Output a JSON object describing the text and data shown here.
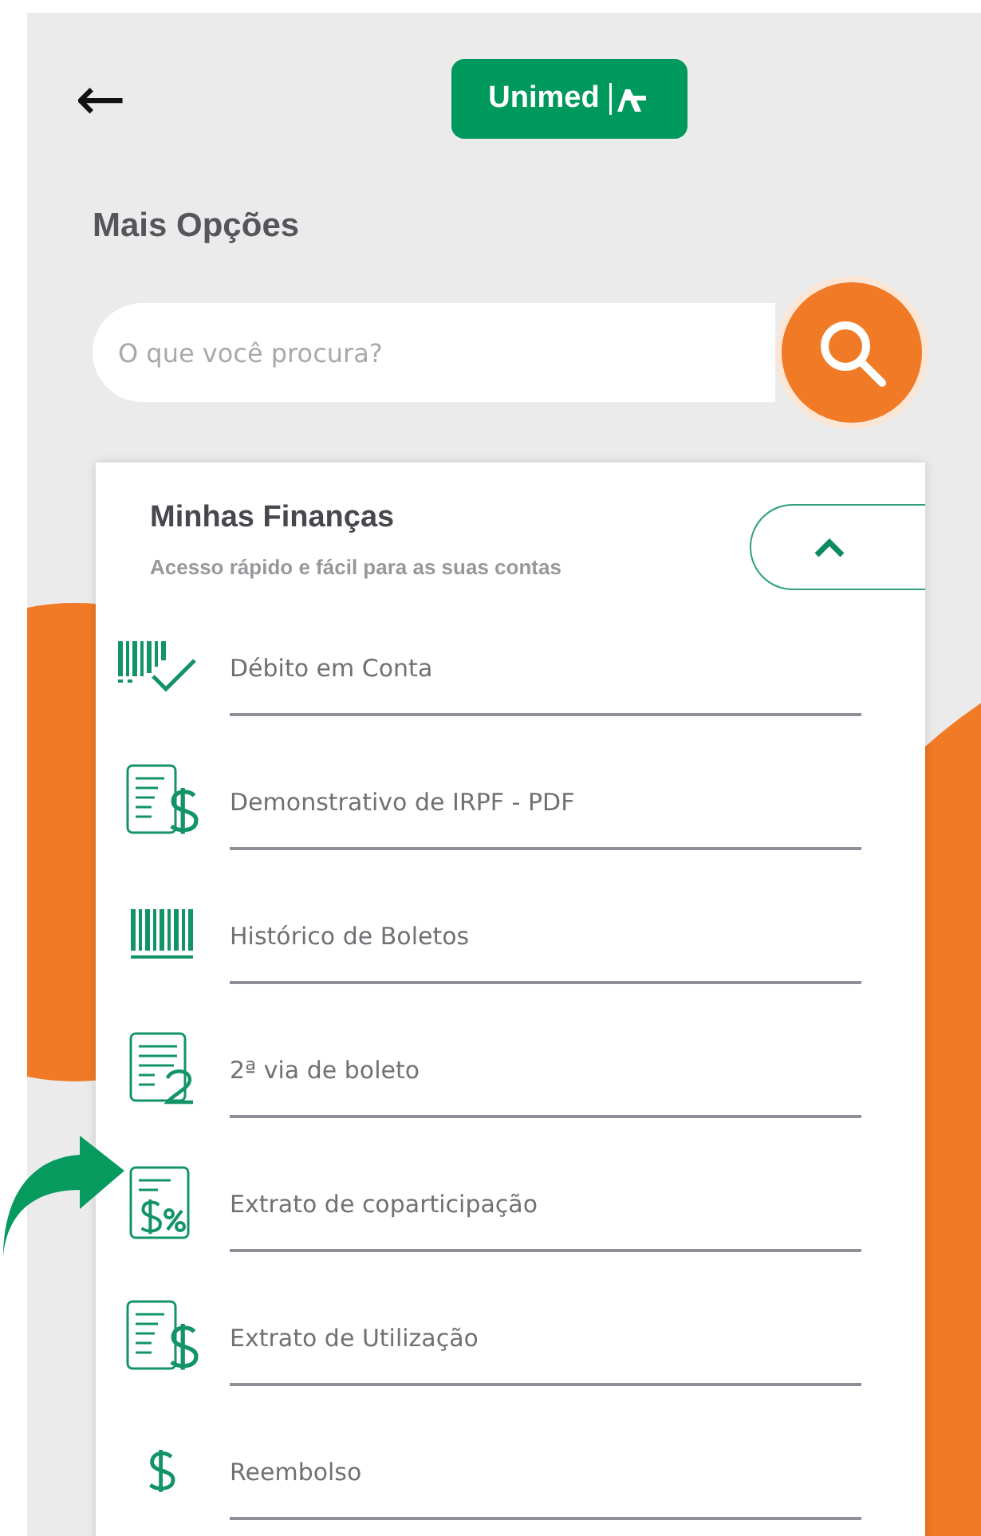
{
  "header": {
    "back_label": "←",
    "logo_text": "Unimed"
  },
  "title": "Mais Opções",
  "search": {
    "placeholder": "O que você procura?"
  },
  "section": {
    "title": "Minhas Finanças",
    "subtitle": "Acesso rápido e fácil para as suas contas",
    "expanded": true,
    "items": [
      {
        "label": "Débito em Conta",
        "kind": "barcode-check",
        "highlighted": false
      },
      {
        "label": "Demonstrativo de IRPF - PDF",
        "kind": "doc-dollar",
        "highlighted": false
      },
      {
        "label": "Histórico de Boletos",
        "kind": "barcode",
        "highlighted": false
      },
      {
        "label": "2ª via de boleto",
        "kind": "doc-two",
        "highlighted": false
      },
      {
        "label": "Extrato de coparticipação",
        "kind": "doc-percent",
        "highlighted": true
      },
      {
        "label": "Extrato de Utilização",
        "kind": "doc-dollar",
        "highlighted": false
      },
      {
        "label": "Reembolso",
        "kind": "dollar",
        "highlighted": false
      }
    ]
  }
}
